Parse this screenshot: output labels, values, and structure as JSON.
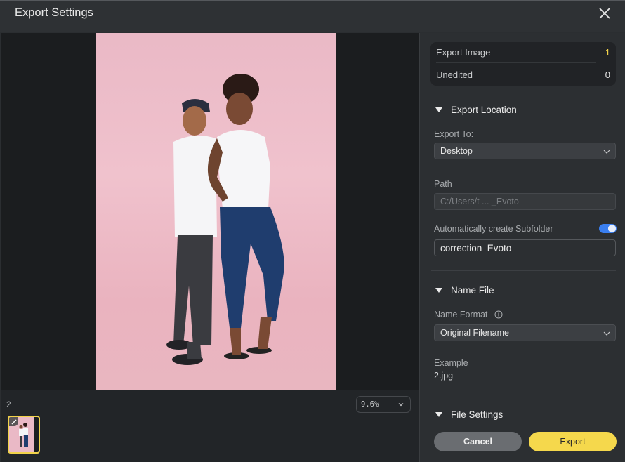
{
  "window": {
    "title": "Export Settings",
    "close_icon": "close-icon"
  },
  "preview": {
    "image_alt": "Two people in white t-shirts and jeans standing back to back against a pink backdrop",
    "background_color": "#eab9c6"
  },
  "filmstrip": {
    "count": "2",
    "zoom_level": "9.6%",
    "thumbnails": [
      {
        "selected": true,
        "edited": true
      }
    ],
    "selected_border_color": "#f2d34a"
  },
  "summary": {
    "rows": [
      {
        "label": "Export Image",
        "value": "1"
      },
      {
        "label": "Unedited",
        "value": "0"
      }
    ]
  },
  "export_location": {
    "heading": "Export Location",
    "export_to_label": "Export To:",
    "export_to_value": "Desktop",
    "path_label": "Path",
    "path_value": "C:/Users/t ... _Evoto",
    "subfolder_label": "Automatically create Subfolder",
    "subfolder_enabled": true,
    "subfolder_value": "correction_Evoto"
  },
  "name_file": {
    "heading": "Name File",
    "format_label": "Name Format",
    "format_value": "Original Filename",
    "example_label": "Example",
    "example_value": "2.jpg"
  },
  "file_settings": {
    "heading": "File Settings"
  },
  "actions": {
    "cancel_label": "Cancel",
    "export_label": "Export"
  },
  "colors": {
    "accent_yellow": "#f5d84c",
    "toggle_blue": "#3a7ff0"
  }
}
